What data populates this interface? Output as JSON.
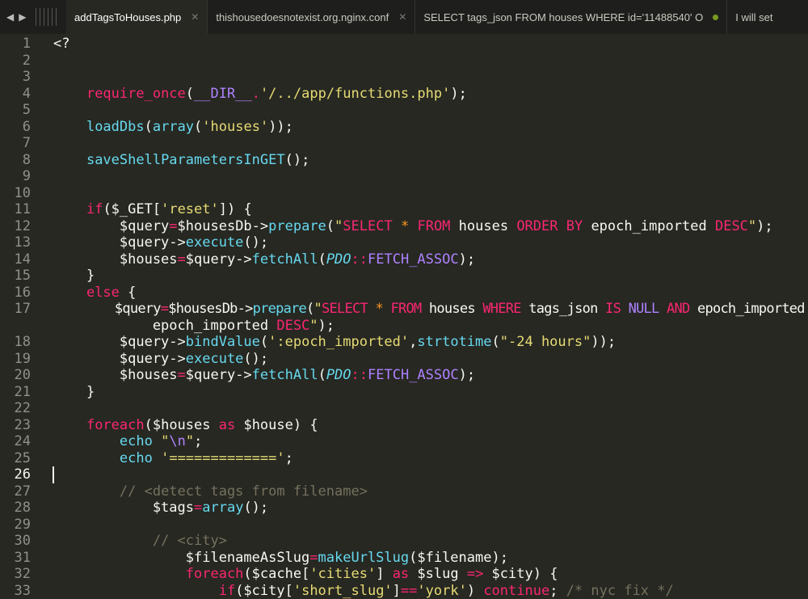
{
  "tabs": [
    {
      "label": "addTagsToHouses.php",
      "active": true,
      "icon": "close-icon"
    },
    {
      "label": "thishousedoesnotexist.org.nginx.conf",
      "icon": "close-icon"
    },
    {
      "label": "SELECT tags_json FROM houses WHERE id='11488540' O",
      "icon": "modified-dot-icon"
    },
    {
      "label": "I will set"
    }
  ],
  "nav": {
    "back": "◀",
    "forward": "▶"
  },
  "current_line": "26",
  "lines": [
    {
      "n": "1",
      "t": [
        [
          "w",
          "<?"
        ]
      ]
    },
    {
      "n": "2",
      "t": []
    },
    {
      "n": "3",
      "t": []
    },
    {
      "n": "4",
      "t": [
        [
          "w",
          "    "
        ],
        [
          "k",
          "require_once"
        ],
        [
          "w",
          "("
        ],
        [
          "p",
          "__DIR__"
        ],
        [
          "k",
          "."
        ],
        [
          "s",
          "'/../app/functions.php'"
        ],
        [
          "w",
          ");"
        ]
      ]
    },
    {
      "n": "5",
      "t": []
    },
    {
      "n": "6",
      "t": [
        [
          "w",
          "    "
        ],
        [
          "f",
          "loadDbs"
        ],
        [
          "w",
          "("
        ],
        [
          "f",
          "array"
        ],
        [
          "w",
          "("
        ],
        [
          "s",
          "'houses'"
        ],
        [
          "w",
          "));"
        ]
      ]
    },
    {
      "n": "7",
      "t": []
    },
    {
      "n": "8",
      "t": [
        [
          "w",
          "    "
        ],
        [
          "f",
          "saveShellParametersInGET"
        ],
        [
          "w",
          "();"
        ]
      ]
    },
    {
      "n": "9",
      "t": []
    },
    {
      "n": "10",
      "t": []
    },
    {
      "n": "11",
      "t": [
        [
          "w",
          "    "
        ],
        [
          "k",
          "if"
        ],
        [
          "w",
          "($_GET["
        ],
        [
          "s",
          "'reset'"
        ],
        [
          "w",
          "]) {"
        ]
      ]
    },
    {
      "n": "12",
      "t": [
        [
          "w",
          "        $query"
        ],
        [
          "k",
          "="
        ],
        [
          "w",
          "$housesDb->"
        ],
        [
          "f",
          "prepare"
        ],
        [
          "w",
          "("
        ],
        [
          "s",
          "\""
        ],
        [
          "k",
          "SELECT"
        ],
        [
          "s",
          " "
        ],
        [
          "o",
          "*"
        ],
        [
          "s",
          " "
        ],
        [
          "k",
          "FROM"
        ],
        [
          "w",
          " houses "
        ],
        [
          "k",
          "ORDER BY"
        ],
        [
          "w",
          " epoch_imported "
        ],
        [
          "k",
          "DESC"
        ],
        [
          "s",
          "\""
        ],
        [
          "w",
          ");"
        ]
      ]
    },
    {
      "n": "13",
      "t": [
        [
          "w",
          "        $query->"
        ],
        [
          "f",
          "execute"
        ],
        [
          "w",
          "();"
        ]
      ]
    },
    {
      "n": "14",
      "t": [
        [
          "w",
          "        $houses"
        ],
        [
          "k",
          "="
        ],
        [
          "w",
          "$query->"
        ],
        [
          "f",
          "fetchAll"
        ],
        [
          "w",
          "("
        ],
        [
          "i",
          "PDO"
        ],
        [
          "k",
          "::"
        ],
        [
          "p",
          "FETCH_ASSOC"
        ],
        [
          "w",
          ");"
        ]
      ]
    },
    {
      "n": "15",
      "t": [
        [
          "w",
          "    }"
        ]
      ]
    },
    {
      "n": "16",
      "t": [
        [
          "w",
          "    "
        ],
        [
          "k",
          "else"
        ],
        [
          "w",
          " {"
        ]
      ]
    },
    {
      "n": "17",
      "t": [
        [
          "w",
          "        $query"
        ],
        [
          "k",
          "="
        ],
        [
          "w",
          "$housesDb->"
        ],
        [
          "f",
          "prepare"
        ],
        [
          "w",
          "("
        ],
        [
          "s",
          "\""
        ],
        [
          "k",
          "SELECT"
        ],
        [
          "s",
          " "
        ],
        [
          "o",
          "*"
        ],
        [
          "s",
          " "
        ],
        [
          "k",
          "FROM"
        ],
        [
          "w",
          " houses "
        ],
        [
          "k",
          "WHERE"
        ],
        [
          "w",
          " tags_json "
        ],
        [
          "k",
          "IS"
        ],
        [
          "w",
          " "
        ],
        [
          "p",
          "NULL"
        ],
        [
          "w",
          " "
        ],
        [
          "k",
          "AND"
        ],
        [
          "w",
          " epoch_imported"
        ]
      ]
    },
    {
      "n": "",
      "t": [
        [
          "w",
          "            epoch_imported "
        ],
        [
          "k",
          "DESC"
        ],
        [
          "s",
          "\""
        ],
        [
          "w",
          ");"
        ]
      ]
    },
    {
      "n": "18",
      "t": [
        [
          "w",
          "        $query->"
        ],
        [
          "f",
          "bindValue"
        ],
        [
          "w",
          "("
        ],
        [
          "s",
          "':epoch_imported'"
        ],
        [
          "w",
          ","
        ],
        [
          "f",
          "strtotime"
        ],
        [
          "w",
          "("
        ],
        [
          "s",
          "\"-24 hours\""
        ],
        [
          "w",
          "));"
        ]
      ]
    },
    {
      "n": "19",
      "t": [
        [
          "w",
          "        $query->"
        ],
        [
          "f",
          "execute"
        ],
        [
          "w",
          "();"
        ]
      ]
    },
    {
      "n": "20",
      "t": [
        [
          "w",
          "        $houses"
        ],
        [
          "k",
          "="
        ],
        [
          "w",
          "$query->"
        ],
        [
          "f",
          "fetchAll"
        ],
        [
          "w",
          "("
        ],
        [
          "i",
          "PDO"
        ],
        [
          "k",
          "::"
        ],
        [
          "p",
          "FETCH_ASSOC"
        ],
        [
          "w",
          ");"
        ]
      ]
    },
    {
      "n": "21",
      "t": [
        [
          "w",
          "    }"
        ]
      ]
    },
    {
      "n": "22",
      "t": []
    },
    {
      "n": "23",
      "t": [
        [
          "w",
          "    "
        ],
        [
          "k",
          "foreach"
        ],
        [
          "w",
          "($houses "
        ],
        [
          "k",
          "as"
        ],
        [
          "w",
          " $house) {"
        ]
      ]
    },
    {
      "n": "24",
      "t": [
        [
          "w",
          "        "
        ],
        [
          "f",
          "echo"
        ],
        [
          "w",
          " "
        ],
        [
          "s",
          "\""
        ],
        [
          "p",
          "\\n"
        ],
        [
          "s",
          "\""
        ],
        [
          "w",
          ";"
        ]
      ]
    },
    {
      "n": "25",
      "t": [
        [
          "w",
          "        "
        ],
        [
          "f",
          "echo"
        ],
        [
          "w",
          " "
        ],
        [
          "s",
          "'============='"
        ],
        [
          "w",
          ";"
        ]
      ]
    },
    {
      "n": "26",
      "t": []
    },
    {
      "n": "27",
      "t": [
        [
          "w",
          "        "
        ],
        [
          "c",
          "// <detect tags from filename>"
        ]
      ]
    },
    {
      "n": "28",
      "t": [
        [
          "w",
          "            $tags"
        ],
        [
          "k",
          "="
        ],
        [
          "f",
          "array"
        ],
        [
          "w",
          "();"
        ]
      ]
    },
    {
      "n": "29",
      "t": []
    },
    {
      "n": "30",
      "t": [
        [
          "w",
          "            "
        ],
        [
          "c",
          "// <city>"
        ]
      ]
    },
    {
      "n": "31",
      "t": [
        [
          "w",
          "                $filenameAsSlug"
        ],
        [
          "k",
          "="
        ],
        [
          "f",
          "makeUrlSlug"
        ],
        [
          "w",
          "($filename);"
        ]
      ]
    },
    {
      "n": "32",
      "t": [
        [
          "w",
          "                "
        ],
        [
          "k",
          "foreach"
        ],
        [
          "w",
          "($cache["
        ],
        [
          "s",
          "'cities'"
        ],
        [
          "w",
          "] "
        ],
        [
          "k",
          "as"
        ],
        [
          "w",
          " $slug "
        ],
        [
          "k",
          "=>"
        ],
        [
          "w",
          " $city) {"
        ]
      ]
    },
    {
      "n": "33",
      "t": [
        [
          "w",
          "                    "
        ],
        [
          "k",
          "if"
        ],
        [
          "w",
          "($city["
        ],
        [
          "s",
          "'short_slug'"
        ],
        [
          "w",
          "]"
        ],
        [
          "k",
          "=="
        ],
        [
          "s",
          "'york'"
        ],
        [
          "w",
          ") "
        ],
        [
          "k",
          "continue"
        ],
        [
          "w",
          "; "
        ],
        [
          "c",
          "/* nyc fix */"
        ]
      ]
    }
  ]
}
